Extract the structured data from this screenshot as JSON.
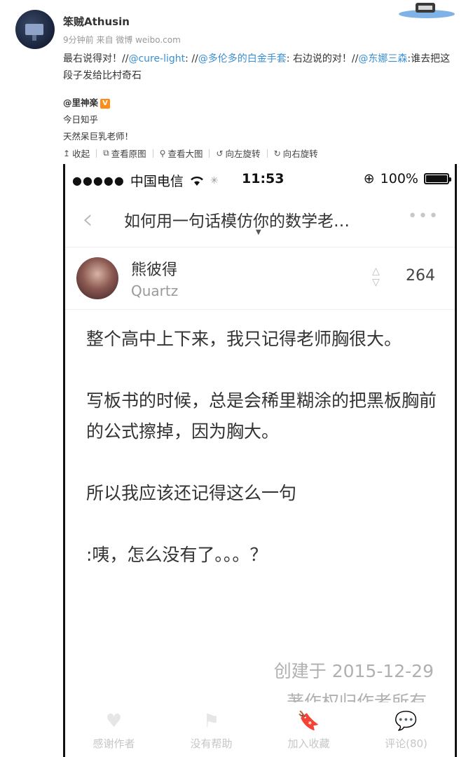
{
  "post": {
    "username": "笨贼Athusin",
    "meta": "9分钟前 来自 微博 weibo.com",
    "text_segments": [
      {
        "t": "最右说得对！//",
        "m": false
      },
      {
        "t": "@cure-light",
        "m": true
      },
      {
        "t": ": //",
        "m": false
      },
      {
        "t": "@多伦多的白金手套",
        "m": true
      },
      {
        "t": ": 右边说的对！//",
        "m": false
      },
      {
        "t": "@东娜三森",
        "m": true
      },
      {
        "t": ":谁去把这段子发给比村奇石",
        "m": false
      }
    ],
    "repost": {
      "author": "@里神楽",
      "badge": "V",
      "line1": "今日知乎",
      "line2": "天然呆巨乳老师！"
    },
    "toolbar": [
      {
        "icon": "collapse-icon",
        "glyph": "↥",
        "label": "收起"
      },
      {
        "icon": "external-link-icon",
        "glyph": "⧉",
        "label": "查看原图"
      },
      {
        "icon": "magnifier-icon",
        "glyph": "⚲",
        "label": "查看大图"
      },
      {
        "icon": "rotate-left-icon",
        "glyph": "↺",
        "label": "向左旋转"
      },
      {
        "icon": "rotate-right-icon",
        "glyph": "↻",
        "label": "向右旋转"
      }
    ]
  },
  "phone": {
    "status": {
      "signal": "●●●●●",
      "carrier": "中国电信",
      "time": "11:53",
      "battery": "100%"
    },
    "nav": {
      "back": "‹",
      "title": "如何用一句话模仿你的数学老…",
      "more": "•••",
      "caret": "▼"
    },
    "answer": {
      "author": "熊彼得",
      "bio": "Quartz",
      "votes": "264",
      "paragraphs": [
        "整个高中上下来，我只记得老师胸很大。",
        "写板书的时候，总是会稀里糊涂的把黑板胸前的公式擦掉，因为胸大。",
        "所以我应该还记得这么一句",
        ":咦，怎么没有了。。。？"
      ],
      "created": "创建于 2015-12-29",
      "copyright": "著作权归作者所有"
    },
    "tabs": [
      {
        "icon": "heart-icon",
        "glyph": "♥",
        "label": "感谢作者"
      },
      {
        "icon": "flag-icon",
        "glyph": "⚑",
        "label": "没有帮助"
      },
      {
        "icon": "bookmark-icon",
        "glyph": "🔖",
        "label": "加入收藏"
      },
      {
        "icon": "comment-icon",
        "glyph": "💬",
        "label": "评论(80)"
      }
    ]
  }
}
